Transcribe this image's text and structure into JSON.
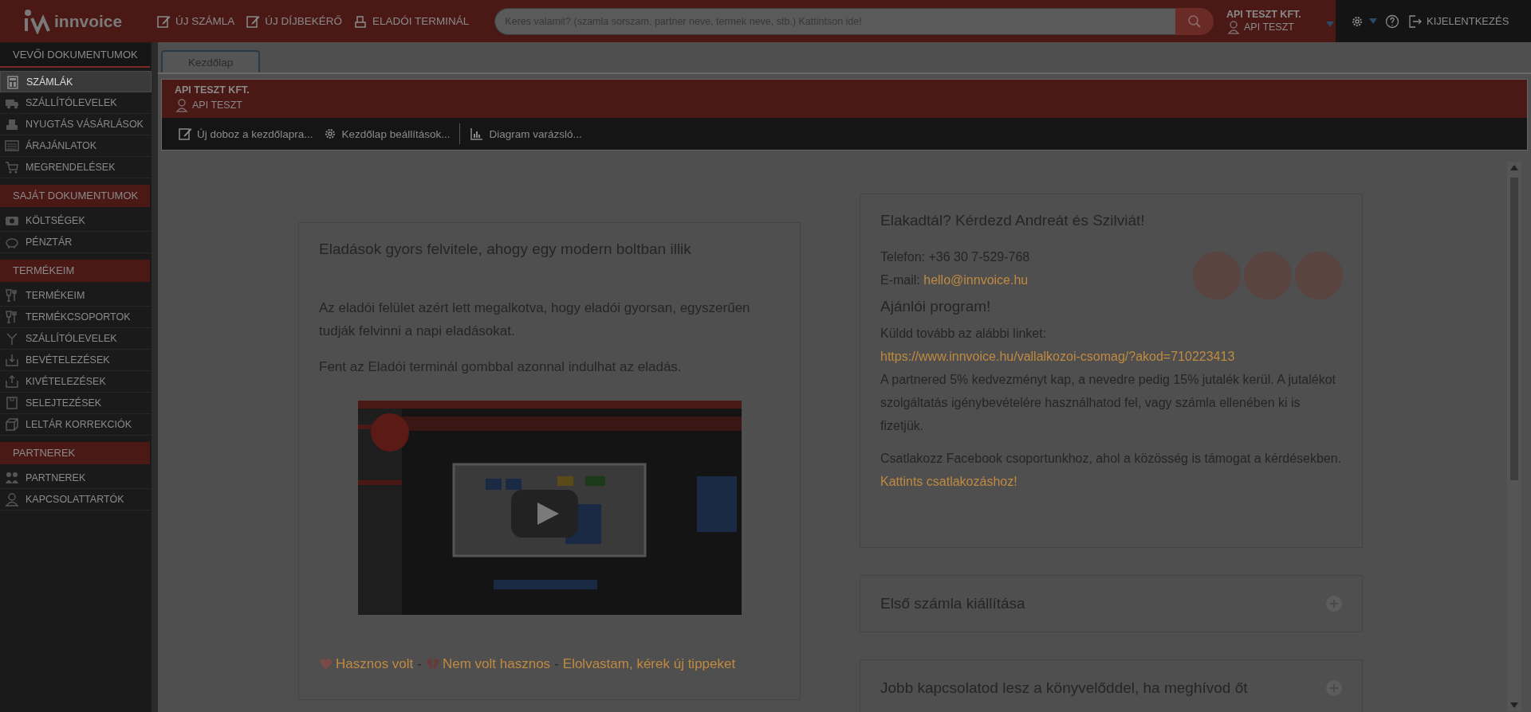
{
  "header": {
    "logo": "innvoice",
    "nav": [
      {
        "label": "ÚJ SZÁMLA"
      },
      {
        "label": "ÚJ DÍJBEKÉRŐ"
      },
      {
        "label": "ELADÓI TERMINÁL"
      }
    ],
    "search": {
      "placeholder": "Keres valamit? (szamla sorszam, partner neve, termek neve, stb.) Kattintson ide!"
    },
    "user": {
      "company": "API TESZT KFT.",
      "name": "API TESZT"
    },
    "logout": "KIJELENTKEZÉS"
  },
  "sidebar": {
    "sections": [
      {
        "title": "VEVŐI DOKUMENTUMOK",
        "items": [
          {
            "label": "SZÁMLÁK",
            "selected": true
          },
          {
            "label": "SZÁLLÍTÓLEVELEK",
            "selected": false
          },
          {
            "label": "NYUGTÁS VÁSÁRLÁSOK",
            "selected": false
          },
          {
            "label": "ÁRAJÁNLATOK",
            "selected": false
          },
          {
            "label": "MEGRENDELÉSEK",
            "selected": false
          }
        ]
      },
      {
        "title": "SAJÁT DOKUMENTUMOK",
        "items": [
          {
            "label": "KÖLTSÉGEK",
            "selected": false
          },
          {
            "label": "PÉNZTÁR",
            "selected": false
          }
        ]
      },
      {
        "title": "TERMÉKEIM",
        "items": [
          {
            "label": "TERMÉKEIM",
            "selected": false
          },
          {
            "label": "TERMÉKCSOPORTOK",
            "selected": false
          },
          {
            "label": "SZÁLLÍTÓLEVELEK",
            "selected": false
          },
          {
            "label": "BEVÉTELEZÉSEK",
            "selected": false
          },
          {
            "label": "KIVÉTELEZÉSEK",
            "selected": false
          },
          {
            "label": "SELEJTEZÉSEK",
            "selected": false
          },
          {
            "label": "LELTÁR KORREKCIÓK",
            "selected": false
          }
        ]
      },
      {
        "title": "PARTNEREK",
        "items": [
          {
            "label": "PARTNEREK",
            "selected": false
          },
          {
            "label": "KAPCSOLATTARTÓK",
            "selected": false
          }
        ]
      }
    ]
  },
  "tabs": [
    {
      "label": "Kezdőlap",
      "selected": true
    }
  ],
  "company_bar": {
    "company": "API TESZT KFT.",
    "user": "API TESZT"
  },
  "toolbar": [
    {
      "label": "Új doboz a kezdőlapra..."
    },
    {
      "label": "Kezdőlap beállítások..."
    },
    {
      "label": "Diagram varázsló..."
    }
  ],
  "tip_card": {
    "title": "Eladások gyors felvitele, ahogy egy modern boltban illik",
    "paragraphs": [
      "Az eladói felület azért lett megalkotva, hogy eladói gyorsan, egyszerűen tudják felvinni a napi eladásokat.",
      "Fent az Eladói terminál gombbal azonnal indulhat az eladás."
    ],
    "video": {
      "kind": "picture"
    },
    "feedback": [
      {
        "kind": "link",
        "label": "Hasznos volt"
      },
      {
        "kind": "separator",
        "label": "-"
      },
      {
        "kind": "link",
        "label": "Nem volt hasznos"
      },
      {
        "kind": "separator",
        "label": "-"
      },
      {
        "kind": "link",
        "label": "Elolvastam, kérek új tippeket"
      }
    ]
  },
  "help_card": {
    "title": "Elakadtál? Kérdezd Andreát és Szilviát!",
    "phone": "Telefon: +36 30 7-529-768",
    "email_label": "E-mail:",
    "email": "hello@innvoice.hu",
    "referral_title": "Ajánlói program!",
    "referral_intro": "Küldd tovább az alábbi linket:",
    "referral_link": "https://www.innvoice.hu/vallalkozoi-csomag/?akod=710223413",
    "referral_text": "A partnered 5% kedvezményt kap, a nevedre pedig 15% jutalék kerül. A jutalékot szolgáltatás igénybevételére használhatod fel, vagy számla ellenében ki is fizetjük.",
    "facebook_text": "Csatlakozz Facebook csoportunkhoz, ahol a közösség is támogat a kérdésekben.",
    "facebook_link": "Kattints csatlakozáshoz!"
  },
  "accordion": [
    {
      "title": "Első számla kiállítása",
      "expanded": false
    },
    {
      "title": "Jobb kapcsolatod lesz a könyvelőddel, ha meghívod őt",
      "expanded": false
    }
  ]
}
